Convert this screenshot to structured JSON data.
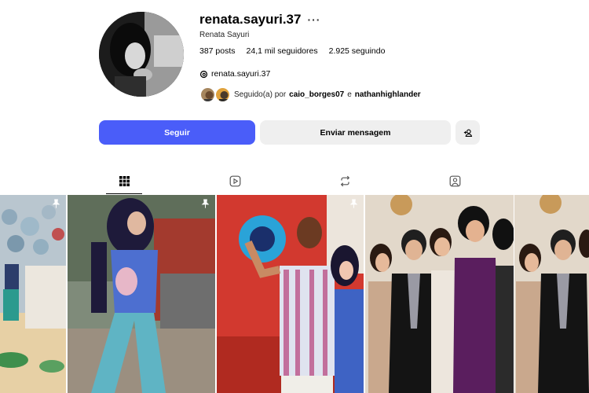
{
  "profile": {
    "username": "renata.sayuri.37",
    "more_glyph": "···",
    "full_name": "Renata Sayuri",
    "stats": {
      "posts": "387 posts",
      "followers": "24,1 mil seguidores",
      "following": "2.925 seguindo"
    },
    "threads_handle": "renata.sayuri.37",
    "followed_by": {
      "prefix": "Seguido(a) por",
      "user1": "caio_borges07",
      "connector": "e",
      "user2": "nathanhighlander"
    }
  },
  "actions": {
    "follow_label": "Seguir",
    "message_label": "Enviar mensagem",
    "add_user_icon": "person-plus-icon"
  },
  "tabs": [
    {
      "icon": "grid-icon",
      "active": true
    },
    {
      "icon": "reels-icon",
      "active": false
    },
    {
      "icon": "repost-icon",
      "active": false
    },
    {
      "icon": "tagged-icon",
      "active": false
    }
  ],
  "posts": [
    {
      "pinned": true
    },
    {
      "pinned": true
    },
    {
      "pinned": true
    },
    {
      "pinned": false
    },
    {
      "pinned": false
    }
  ],
  "colors": {
    "accent": "#4a5df9",
    "secondary_button": "#efefef"
  }
}
